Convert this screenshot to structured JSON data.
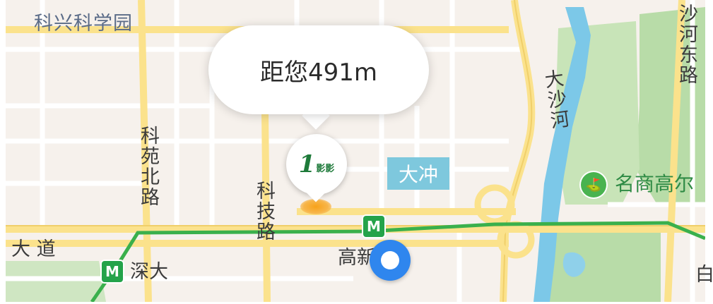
{
  "map": {
    "places": {
      "kexing_science_park": "科兴科学园",
      "dachong": "大冲",
      "mingshang": "名商高尔"
    },
    "roads": {
      "keyuan_north": "科苑北路",
      "keji": "科技路",
      "dashahe": "大沙河",
      "shahe_east": "沙河东路",
      "avenue": "大 道"
    },
    "stations": {
      "shenda": "深大",
      "gaoxin": "高新园"
    },
    "metro_symbol": "M",
    "bubble_text": "距您491m",
    "poi_logo": {
      "numeral": "1",
      "text": "影影"
    },
    "edge_char": "白",
    "mall_icon_glyph": "⛳",
    "colors": {
      "land": "#f6f1ec",
      "road": "#ffffff",
      "major_road": "#fbe28c",
      "water": "#7cc8e8",
      "park": "#b8dca8",
      "metro_line": "#3ab04c",
      "location_dot": "#2f86ee"
    }
  }
}
